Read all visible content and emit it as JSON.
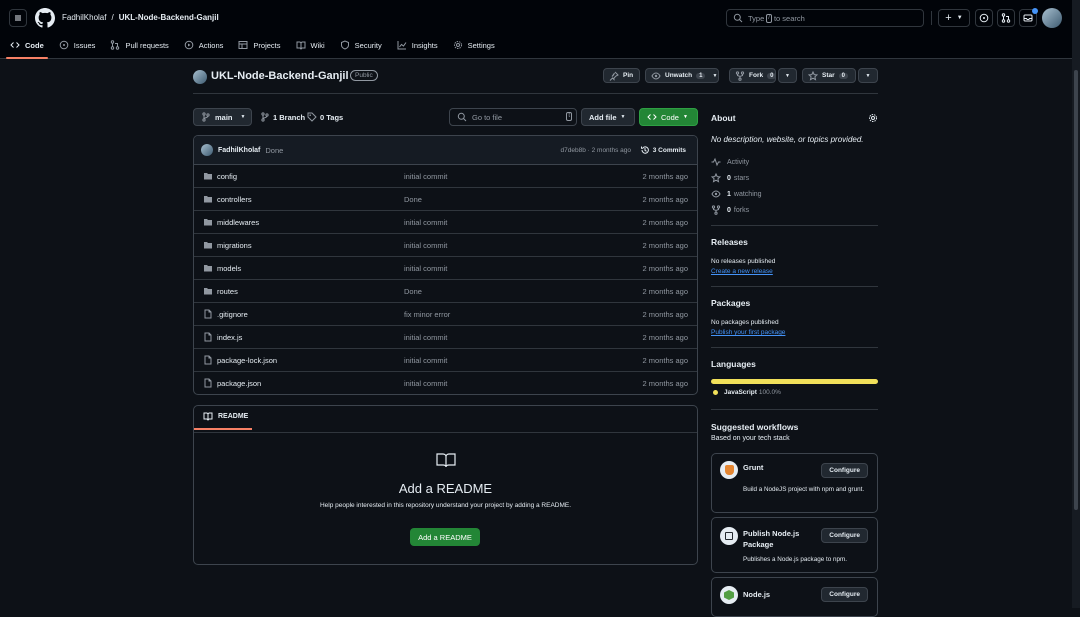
{
  "header": {
    "owner": "FadhilKholaf",
    "sep": "/",
    "repo": "UKL-Node-Backend-Ganjil",
    "search_prefix": "Type",
    "search_key": "/",
    "search_suffix": "to search"
  },
  "nav": [
    {
      "label": "Code",
      "icon": "code-icon",
      "active": true
    },
    {
      "label": "Issues",
      "icon": "issue-icon"
    },
    {
      "label": "Pull requests",
      "icon": "pull-request-icon"
    },
    {
      "label": "Actions",
      "icon": "play-icon"
    },
    {
      "label": "Projects",
      "icon": "table-icon"
    },
    {
      "label": "Wiki",
      "icon": "book-icon"
    },
    {
      "label": "Security",
      "icon": "shield-icon"
    },
    {
      "label": "Insights",
      "icon": "graph-icon"
    },
    {
      "label": "Settings",
      "icon": "gear-icon"
    }
  ],
  "repo_head": {
    "name": "UKL-Node-Backend-Ganjil",
    "visibility": "Public",
    "pin": "Pin",
    "unwatch": "Unwatch",
    "unwatch_count": "1",
    "fork": "Fork",
    "fork_count": "0",
    "star": "Star",
    "star_count": "0"
  },
  "toolbar": {
    "branch": "main",
    "branches": "1 Branch",
    "tags": "0 Tags",
    "goto": "Go to file",
    "goto_key": "t",
    "add_file": "Add file",
    "code": "Code"
  },
  "commit": {
    "author": "FadhilKholaf",
    "message": "Done",
    "hash": "d7deb8b",
    "ago": "· 2 months ago",
    "commits": "3 Commits"
  },
  "files": [
    {
      "name": "config",
      "type": "dir",
      "msg": "initial commit",
      "time": "2 months ago"
    },
    {
      "name": "controllers",
      "type": "dir",
      "msg": "Done",
      "time": "2 months ago"
    },
    {
      "name": "middlewares",
      "type": "dir",
      "msg": "initial commit",
      "time": "2 months ago"
    },
    {
      "name": "migrations",
      "type": "dir",
      "msg": "initial commit",
      "time": "2 months ago"
    },
    {
      "name": "models",
      "type": "dir",
      "msg": "initial commit",
      "time": "2 months ago"
    },
    {
      "name": "routes",
      "type": "dir",
      "msg": "Done",
      "time": "2 months ago"
    },
    {
      "name": ".gitignore",
      "type": "file",
      "msg": "fix minor error",
      "time": "2 months ago"
    },
    {
      "name": "index.js",
      "type": "file",
      "msg": "initial commit",
      "time": "2 months ago"
    },
    {
      "name": "package-lock.json",
      "type": "file",
      "msg": "initial commit",
      "time": "2 months ago"
    },
    {
      "name": "package.json",
      "type": "file",
      "msg": "initial commit",
      "time": "2 months ago"
    }
  ],
  "readme": {
    "tab": "README",
    "title": "Add a README",
    "desc": "Help people interested in this repository understand your project by adding a README.",
    "button": "Add a README"
  },
  "about": {
    "title": "About",
    "desc": "No description, website, or topics provided.",
    "activity": "Activity",
    "stars_n": "0",
    "stars": "stars",
    "watching_n": "1",
    "watching": "watching",
    "forks_n": "0",
    "forks": "forks"
  },
  "releases": {
    "title": "Releases",
    "none": "No releases published",
    "link": "Create a new release"
  },
  "packages": {
    "title": "Packages",
    "none": "No packages published",
    "link": "Publish your first package"
  },
  "languages": {
    "title": "Languages",
    "lang": "JavaScript",
    "pct": "100.0%",
    "color": "#f1e05a",
    "fraction": 1.0
  },
  "workflows": {
    "title": "Suggested workflows",
    "subtitle": "Based on your tech stack",
    "configure": "Configure",
    "items": [
      {
        "name": "Grunt",
        "desc": "Build a NodeJS project with npm and grunt."
      },
      {
        "name": "Publish Node.js Package",
        "desc": "Publishes a Node.js package to npm."
      },
      {
        "name": "Node.js",
        "desc": ""
      }
    ]
  },
  "colors": {
    "accent_green": "#238636",
    "underline": "#f78166",
    "link": "#4493f8"
  }
}
